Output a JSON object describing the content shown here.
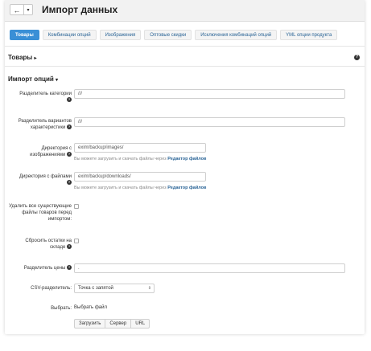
{
  "header": {
    "title": "Импорт данных",
    "back_glyph": "←",
    "dropdown_glyph": "▾"
  },
  "tabs": [
    {
      "label": "Товары",
      "active": true
    },
    {
      "label": "Комбинации опций",
      "active": false
    },
    {
      "label": "Изображения",
      "active": false
    },
    {
      "label": "Оптовые скидки",
      "active": false
    },
    {
      "label": "Исключения комбинаций опций",
      "active": false
    },
    {
      "label": "YML опции продукта",
      "active": false
    }
  ],
  "section_products": {
    "title": "Товары",
    "arrow": "▸"
  },
  "section_import": {
    "title": "Импорт опций",
    "arrow": "▾"
  },
  "help_glyph": "?",
  "fields": {
    "category_delimiter": {
      "label": "Разделитель категории",
      "value": "///"
    },
    "features_delimiter": {
      "label": "Разделитель вариантов характеристики",
      "value": "///"
    },
    "images_dir": {
      "label": "Директория с изображениями",
      "value": "exim/backup/images/",
      "hint": "Вы можете загрузить и скачать файлы через",
      "hint_link": "Редактор файлов"
    },
    "files_dir": {
      "label": "Директория с файлами",
      "value": "exim/backup/downloads/",
      "hint": "Вы можете загрузить и скачать файлы через",
      "hint_link": "Редактор файлов"
    },
    "delete_files": {
      "label": "Удалить все существующие файлы товаров перед импортом:",
      "checked": false
    },
    "reset_stock": {
      "label": "Сбросить остатки на складе",
      "checked": false
    },
    "price_delimiter": {
      "label": "Разделитель цены",
      "value": "."
    },
    "csv_delimiter": {
      "label": "CSV-разделитель:",
      "value": "Точка с запятой"
    },
    "select_file": {
      "label": "Выбрать:",
      "value": "Выбрать файл",
      "buttons": [
        "Загрузить",
        "Сервер",
        "URL"
      ]
    }
  }
}
